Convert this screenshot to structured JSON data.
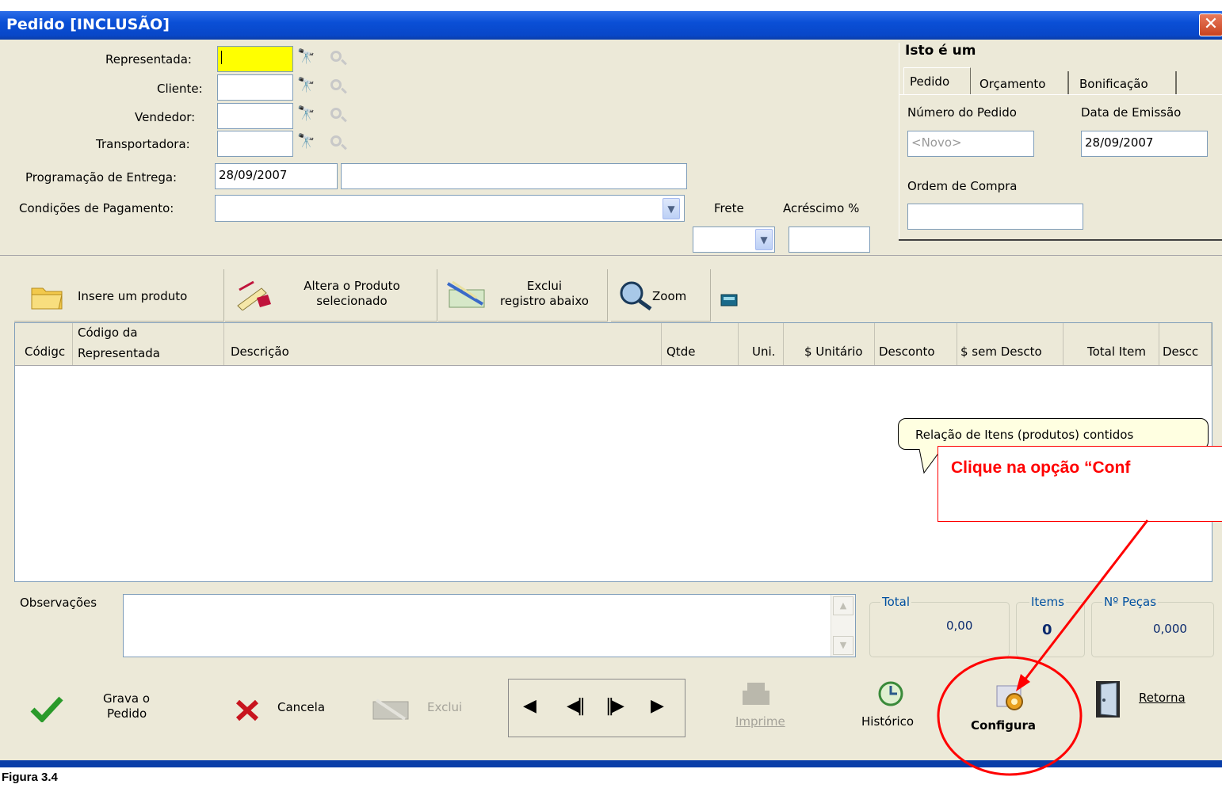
{
  "window": {
    "title": "Pedido [INCLUSÃO]",
    "close_glyph": "✕"
  },
  "form": {
    "representada_label": "Representada:",
    "cliente_label": "Cliente:",
    "vendedor_label": "Vendedor:",
    "transportadora_label": "Transportadora:",
    "programacao_label": "Programação de Entrega:",
    "programacao_value": "28/09/2007",
    "condicoes_label": "Condições de Pagamento:",
    "frete_label": "Frete",
    "acrescimo_label": "Acréscimo %"
  },
  "tipo": {
    "heading": "Isto é um",
    "tabs": [
      {
        "label": "Pedido",
        "active": true
      },
      {
        "label": "Orçamento",
        "active": false
      },
      {
        "label": "Bonificação",
        "active": false
      }
    ],
    "numero_label": "Número do Pedido",
    "numero_value": "<Novo>",
    "data_label": "Data de Emissão",
    "data_value": "28/09/2007",
    "ordem_label": "Ordem de Compra"
  },
  "toolbar": {
    "insere": "Insere um produto",
    "altera_line1": "Altera o Produto",
    "altera_line2": "selecionado",
    "exclui_line1": "Exclui",
    "exclui_line2": "registro abaixo",
    "zoom": "Zoom"
  },
  "grid": {
    "columns": [
      {
        "line1": "Códigc",
        "line2": ""
      },
      {
        "line1": "Código da",
        "line2": "Representada"
      },
      {
        "line1": "Descrição",
        "line2": ""
      },
      {
        "line1": "Qtde",
        "line2": ""
      },
      {
        "line1": "Uni.",
        "line2": ""
      },
      {
        "line1": "$ Unitário",
        "line2": ""
      },
      {
        "line1": "Desconto",
        "line2": ""
      },
      {
        "line1": "$ sem Descto",
        "line2": ""
      },
      {
        "line1": "Total Item",
        "line2": ""
      },
      {
        "line1": "Descc",
        "line2": ""
      }
    ],
    "rows": []
  },
  "tooltip": "Relação de Itens (produtos) contidos",
  "annotation": {
    "callout": "Clique na opção “Conf",
    "color": "#ff0000"
  },
  "observacoes_label": "Observações",
  "summary": {
    "total_label": "Total",
    "total_value": "0,00",
    "items_label": "Items",
    "items_value": "0",
    "pecas_label": "Nº Peças",
    "pecas_value": "0,000"
  },
  "bottom": {
    "grava_line1": "Grava o",
    "grava_line2": "Pedido",
    "cancela": "Cancela",
    "exclui": "Exclui",
    "imprime": "Imprime",
    "historico": "Histórico",
    "configura": "Configura",
    "retorna": "Retorna"
  },
  "caption": "Figura 3.4"
}
